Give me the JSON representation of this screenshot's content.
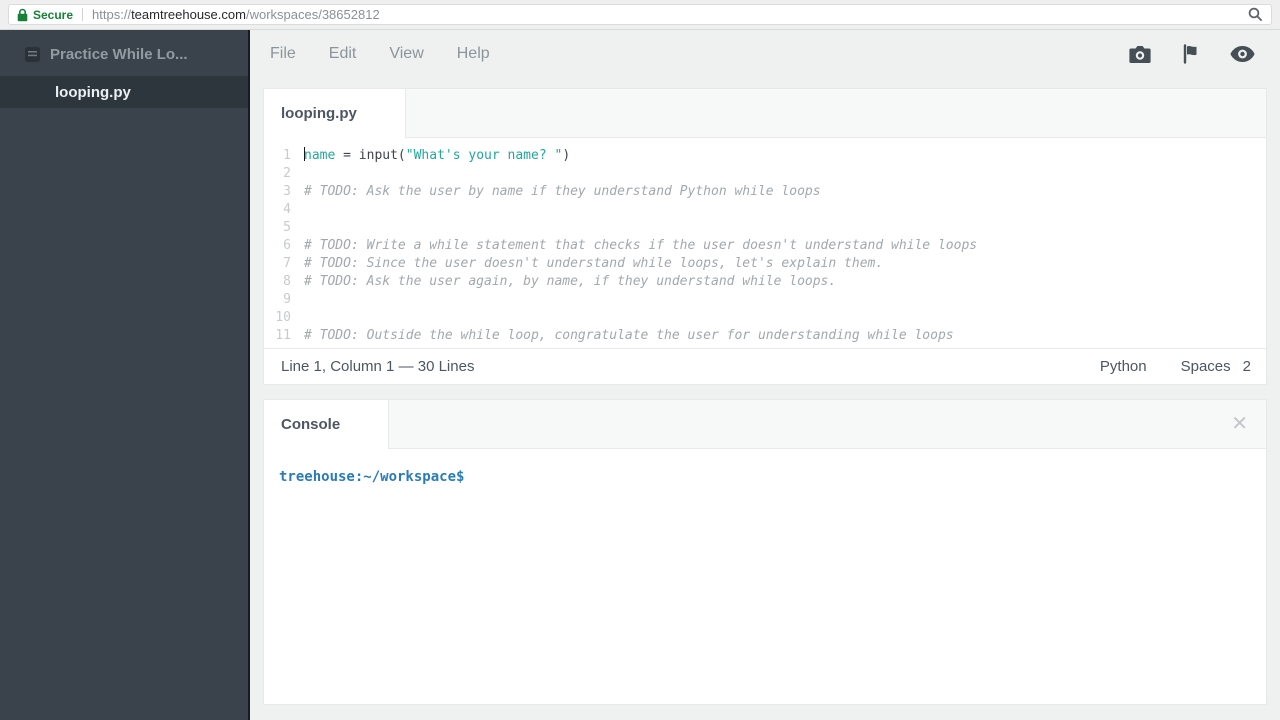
{
  "browser": {
    "secure_label": "Secure",
    "url_scheme": "https://",
    "url_host": "teamtreehouse.com",
    "url_path": "/workspaces/38652812"
  },
  "sidebar": {
    "workspace_title": "Practice While Lo...",
    "file_name": "looping.py"
  },
  "menu": {
    "items": [
      "File",
      "Edit",
      "View",
      "Help"
    ]
  },
  "editor": {
    "tab_label": "looping.py",
    "cursor": {
      "line": 1,
      "column": 1
    },
    "lines": [
      {
        "num": 1,
        "caret": true,
        "segments": [
          {
            "type": "ident",
            "text": "name"
          },
          {
            "type": "plain",
            "text": " = input("
          },
          {
            "type": "str",
            "text": "\"What's your name? \""
          },
          {
            "type": "plain",
            "text": ")"
          }
        ]
      },
      {
        "num": 2,
        "segments": []
      },
      {
        "num": 3,
        "segments": [
          {
            "type": "comment",
            "text": "# TODO: Ask the user by name if they understand Python while loops"
          }
        ]
      },
      {
        "num": 4,
        "segments": []
      },
      {
        "num": 5,
        "segments": []
      },
      {
        "num": 6,
        "segments": [
          {
            "type": "comment",
            "text": "# TODO: Write a while statement that checks if the user doesn't understand while loops"
          }
        ]
      },
      {
        "num": 7,
        "segments": [
          {
            "type": "comment",
            "text": "# TODO: Since the user doesn't understand while loops, let's explain them."
          }
        ]
      },
      {
        "num": 8,
        "segments": [
          {
            "type": "comment",
            "text": "# TODO: Ask the user again, by name, if they understand while loops."
          }
        ]
      },
      {
        "num": 9,
        "segments": []
      },
      {
        "num": 10,
        "segments": []
      },
      {
        "num": 11,
        "segments": [
          {
            "type": "comment",
            "text": "# TODO: Outside the while loop, congratulate the user for understanding while loops"
          }
        ]
      }
    ],
    "status": {
      "left": "Line 1, Column 1 — 30 Lines",
      "language": "Python",
      "indent_label": "Spaces",
      "indent_size": "2"
    }
  },
  "console": {
    "tab_label": "Console",
    "prompt": "treehouse:~/workspace$"
  },
  "icons": {
    "close_glyph": "✕"
  },
  "colors": {
    "secure_green": "#188038",
    "code_teal": "#26a69a",
    "prompt_blue": "#2b7cb5",
    "sidebar_bg": "#3a434b"
  }
}
